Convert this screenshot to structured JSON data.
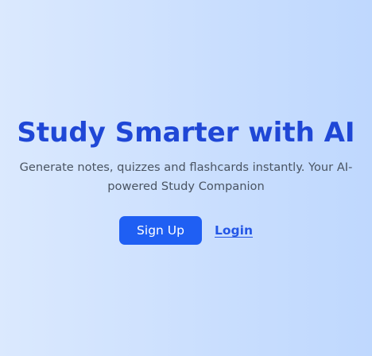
{
  "hero": {
    "title": "Study Smarter with AI",
    "subtitle": "Generate notes, quizzes and flashcards instantly. Your AI-powered Study Companion",
    "signup_label": "Sign Up",
    "login_label": "Login"
  },
  "colors": {
    "accent": "#1f5ff3",
    "title": "#1f47d6",
    "background_start": "#dbe9fe",
    "background_end": "#bfd8fe"
  }
}
